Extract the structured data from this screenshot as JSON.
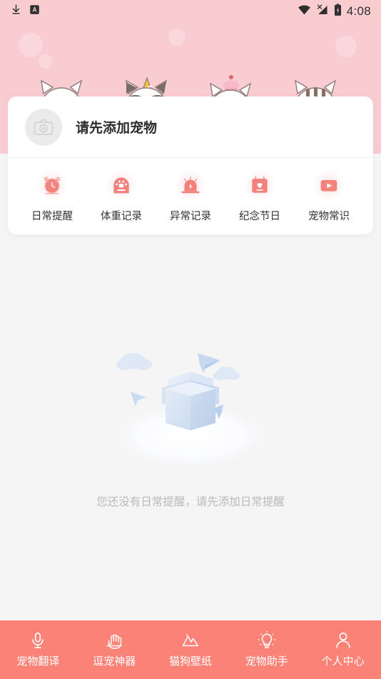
{
  "status_bar": {
    "time": "4:08",
    "icons": [
      {
        "name": "download-icon"
      },
      {
        "name": "app-badge-a-icon",
        "label": "A"
      },
      {
        "name": "wifi-icon"
      },
      {
        "name": "signal-off-icon"
      },
      {
        "name": "battery-charging-icon"
      }
    ]
  },
  "banner": {
    "background_color": "#f9ccd1",
    "cats": [
      {
        "name": "cat-striped-shirt",
        "block_color": "#fbd3ae"
      },
      {
        "name": "cat-party-hat-sunglasses",
        "block_color": "#f7c4cb"
      },
      {
        "name": "cat-cupcake-hat",
        "block_color": "#faf3c6"
      },
      {
        "name": "cat-bowtie-tabby",
        "block_color": "#f9a285"
      }
    ]
  },
  "card": {
    "pet": {
      "avatar_icon": "camera-icon",
      "title": "请先添加宠物"
    },
    "tools": [
      {
        "icon": "alarm-clock-icon",
        "label": "日常提醒"
      },
      {
        "icon": "scale-icon",
        "label": "体重记录"
      },
      {
        "icon": "siren-icon",
        "label": "异常记录"
      },
      {
        "icon": "calendar-heart-icon",
        "label": "纪念节日"
      },
      {
        "icon": "video-play-icon",
        "label": "宠物常识"
      }
    ]
  },
  "empty_state": {
    "illustration": "empty-box-icon",
    "message": "您还没有日常提醒，请先添加日常提醒"
  },
  "bottom_nav": {
    "background_color": "#fa8276",
    "items": [
      {
        "icon": "microphone-icon",
        "label": "宠物翻译"
      },
      {
        "icon": "hand-teasing-icon",
        "label": "逗宠神器"
      },
      {
        "icon": "mountain-wallpaper-icon",
        "label": "猫狗壁纸"
      },
      {
        "icon": "lightbulb-icon",
        "label": "宠物助手"
      },
      {
        "icon": "person-icon",
        "label": "个人中心"
      }
    ]
  },
  "colors": {
    "accent": "#fa8276",
    "banner": "#f9ccd1",
    "icon_tint": "#f4827c",
    "page_background": "#f5f5f6"
  }
}
